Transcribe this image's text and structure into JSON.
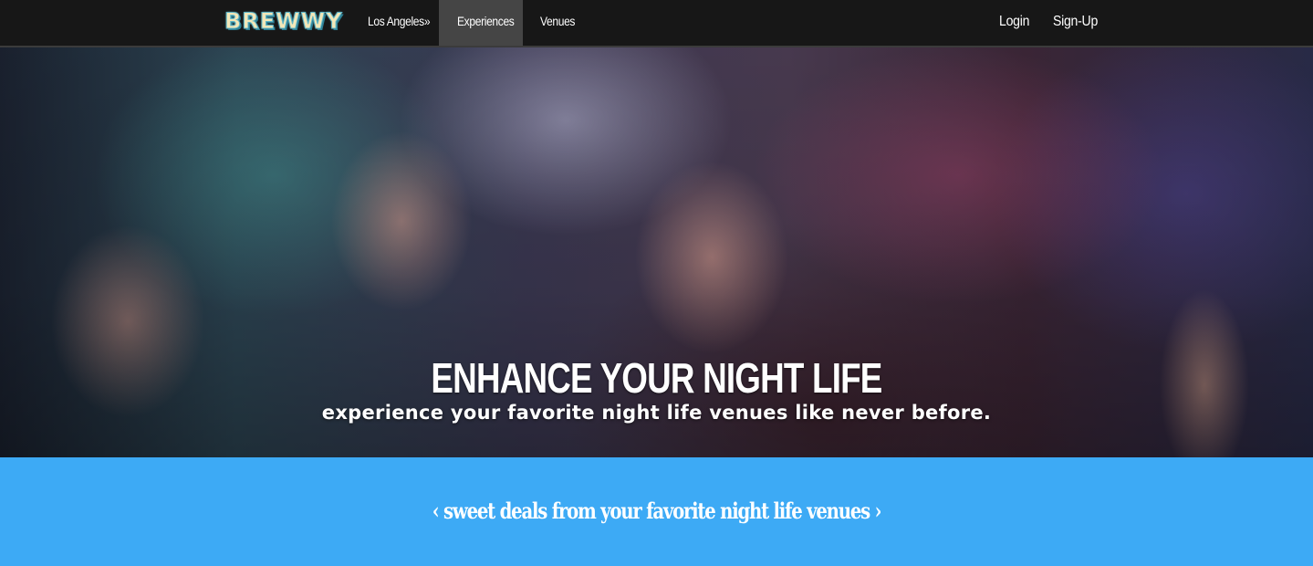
{
  "navbar": {
    "logo": "BREWWY",
    "links": [
      {
        "label": "Los Angeles»"
      },
      {
        "label": "Experiences"
      },
      {
        "label": "Venues"
      }
    ],
    "login": "Login",
    "signup": "Sign-Up"
  },
  "hero": {
    "title": "ENHANCE YOUR NIGHT LIFE",
    "subtitle": "experience your favorite night life venues like never before."
  },
  "deals": {
    "text": "‹ sweet deals from your favorite night life venues ›"
  },
  "colors": {
    "navbar_bg": "#171717",
    "active_tab_bg": "#454545",
    "deals_bg": "#3daaf5"
  }
}
